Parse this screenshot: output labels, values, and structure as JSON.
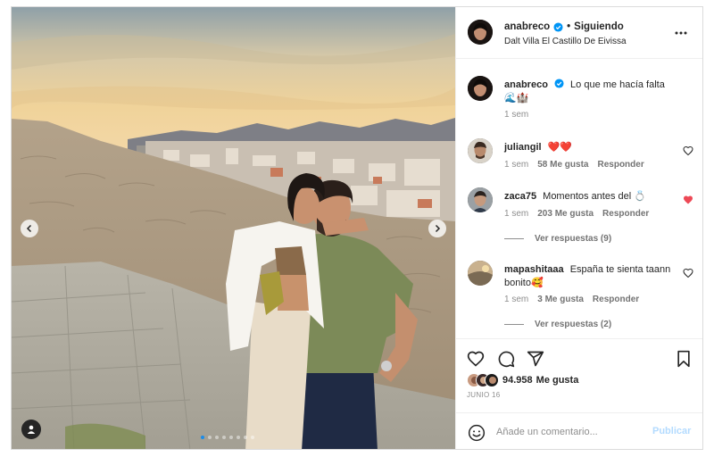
{
  "header": {
    "username": "anabreco",
    "separator": "•",
    "follow_label": "Siguiendo",
    "location": "Dalt Villa El Castillo De Eivissa",
    "verified_icon": "verified-badge-icon",
    "more_icon": "more-options-icon"
  },
  "caption": {
    "username": "anabreco",
    "text": "Lo que me hacía falta 🌊🏰",
    "time": "1 sem"
  },
  "comments": [
    {
      "username": "juliangil",
      "text": "❤️❤️",
      "time": "1 sem",
      "likes": "58 Me gusta",
      "reply_label": "Responder",
      "liked": false
    },
    {
      "username": "zaca75",
      "text": "Momentos antes del 💍",
      "time": "1 sem",
      "likes": "203 Me gusta",
      "reply_label": "Responder",
      "liked": true,
      "view_replies": "Ver respuestas (9)"
    },
    {
      "username": "mapashitaaa",
      "text": "España te sienta taann bonito🥰",
      "time": "1 sem",
      "likes": "3 Me gusta",
      "reply_label": "Responder",
      "liked": false,
      "view_replies": "Ver respuestas (2)"
    }
  ],
  "actions": {
    "like_icon": "heart-icon",
    "comment_icon": "comment-icon",
    "share_icon": "send-icon",
    "save_icon": "bookmark-icon"
  },
  "likes": {
    "count": "94.958",
    "label": "Me gusta"
  },
  "date": "JUNIO 16",
  "add_comment": {
    "placeholder": "Añade un comentario...",
    "publish_label": "Publicar",
    "emoji_icon": "emoji-icon"
  },
  "carousel": {
    "slide_count": 8,
    "active_index": 0
  },
  "colors": {
    "accent": "#0095f6",
    "like_red": "#ed4956",
    "muted": "#8e8e8e",
    "border": "#dbdbdb"
  }
}
